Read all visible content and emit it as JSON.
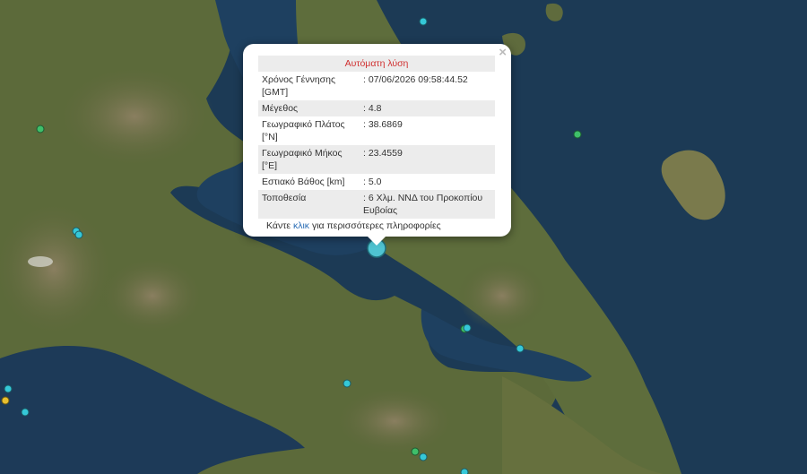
{
  "popup": {
    "title": "Αυτόματη λύση",
    "close_glyph": "×",
    "rows": [
      {
        "label": "Χρόνος Γέννησης [GMT]",
        "value": ": 07/06/2026 09:58:44.52"
      },
      {
        "label": "Μέγεθος",
        "value": ": 4.8"
      },
      {
        "label": "Γεωγραφικό Πλάτος [°N]",
        "value": ": 38.6869"
      },
      {
        "label": "Γεωγραφικό Μήκος [°E]",
        "value": ": 23.4559"
      },
      {
        "label": "Εστιακό Βάθος [km]",
        "value": ": 5.0"
      },
      {
        "label": "Τοποθεσία",
        "value": ": 6 Χλμ. ΝΝΔ του Προκοπίου Ευβοίας"
      }
    ],
    "more_prefix": "Κάντε ",
    "more_link": "κλικ",
    "more_suffix": " για περισσότερες πληροφορίες"
  },
  "colors": {
    "sea": "#1c3a55",
    "land": "#5a6438",
    "selected_marker": "#4fc3d1",
    "marker_cyan": "#35c8d8",
    "marker_green": "#3fbf6a",
    "marker_yellow": "#e8c030",
    "popup_title": "#d03030"
  },
  "markers_icon": "earthquake-marker-icon"
}
